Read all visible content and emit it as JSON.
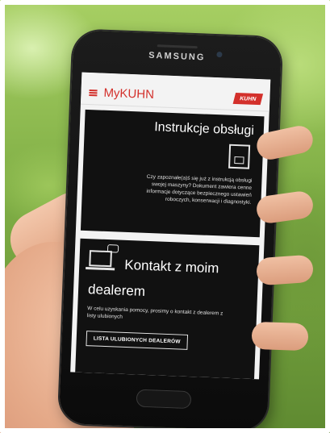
{
  "device": {
    "brand": "SAMSUNG"
  },
  "app": {
    "title": "MyKUHN",
    "logo_text": "KUHN"
  },
  "cards": {
    "manuals": {
      "title": "Instrukcje obsługi",
      "description": "Czy zapoznałe(a)ś się już z instrukcją obsługi swojej maszyny? Dokument zawiera cenne informacje dotyczące bezpiecznego ustawień roboczych, konserwacji i diagnostyki."
    },
    "dealer": {
      "title_line1": "Kontakt z moim",
      "title_line2": "dealerem",
      "description": "W celu uzyskania pomocy, prosimy o kontakt z dealerem z listy ulubionych",
      "button_label": "LISTA ULUBIONYCH DEALERÓW"
    }
  },
  "colors": {
    "accent": "#d3302b",
    "card_bg": "#111111"
  },
  "icons": [
    "menu-icon",
    "binder-icon",
    "laptop-icon",
    "chat-bubble-icon"
  ]
}
